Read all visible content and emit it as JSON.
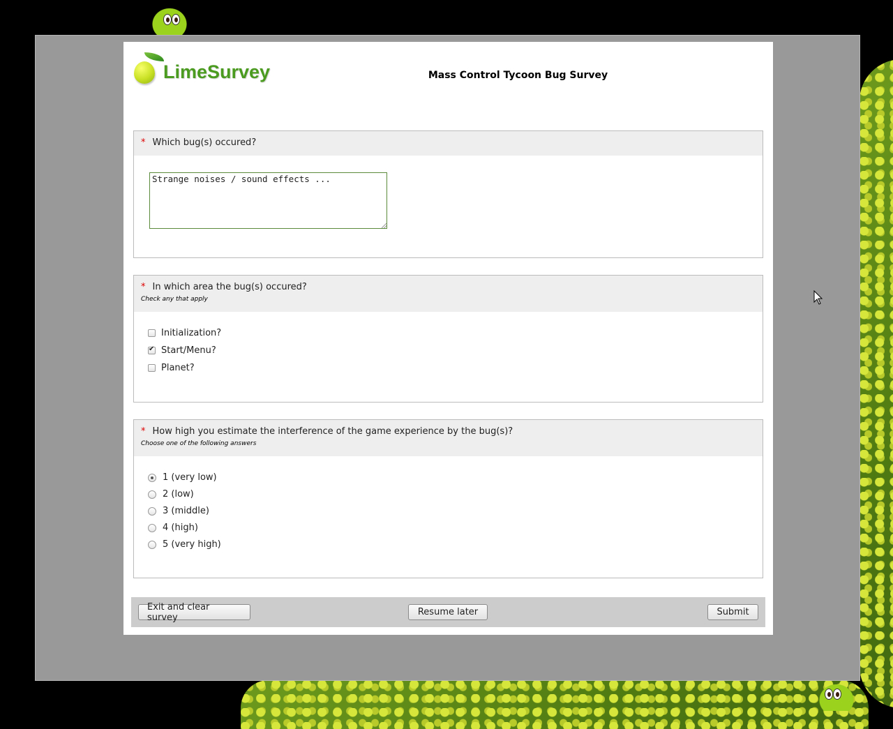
{
  "survey": {
    "logo_text": "LimeSurvey",
    "title": "Mass Control Tycoon Bug Survey"
  },
  "questions": [
    {
      "required_mark": "*",
      "text": "Which bug(s) occured?",
      "answer_value": "Strange noises / sound effects ..."
    },
    {
      "required_mark": "*",
      "text": "In which area the bug(s) occured?",
      "help": "Check any that apply",
      "options": [
        {
          "label": "Initialization?",
          "checked": false
        },
        {
          "label": "Start/Menu?",
          "checked": true
        },
        {
          "label": "Planet?",
          "checked": false
        }
      ]
    },
    {
      "required_mark": "*",
      "text": "How high you estimate the interference of the game experience by the bug(s)?",
      "help": "Choose one of the following answers",
      "options": [
        {
          "label": "1 (very low)",
          "selected": true
        },
        {
          "label": "2 (low)",
          "selected": false
        },
        {
          "label": "3 (middle)",
          "selected": false
        },
        {
          "label": "4 (high)",
          "selected": false
        },
        {
          "label": "5 (very high)",
          "selected": false
        }
      ]
    }
  ],
  "nav": {
    "exit_label": "Exit and clear survey",
    "resume_label": "Resume later",
    "submit_label": "Submit"
  },
  "colors": {
    "required": "#dd0000",
    "question_header_bg": "#eeeeee",
    "page_bg": "#999999",
    "brand_green": "#4a9b1f"
  }
}
